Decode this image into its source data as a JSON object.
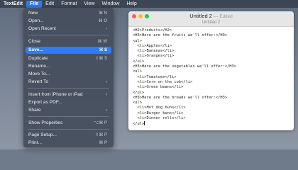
{
  "menubar": {
    "app": "TextEdit",
    "items": [
      "File",
      "Edit",
      "Format",
      "View",
      "Window",
      "Help"
    ]
  },
  "window": {
    "title": "Untitled 2",
    "title_suffix": "— Edited",
    "document_label": "Untitled 2"
  },
  "editor": {
    "lines": [
      "<H2>Products</H2>",
      "<H3>Here are the fruits we'll offer:</H3>",
      "<ul>",
      "  <li>Apples</li>",
      "  <li>Bananas</li>",
      "  <li>Oranges</li>",
      "</ul>",
      "<H3>Here are the vegetables we'll offer:</H3>",
      "<ul>",
      "  <li>Tomatoes</li>",
      "  <li>Corn on the cob</li>",
      "  <li>Green beans</li>",
      "</ul>",
      "<H3>Here are the breads we'll offer:</H3>",
      "<ul>",
      "  <li>Hot dog buns</li>",
      "  <li>Burger buns</li>",
      "  <li>Dinner rolls</li>",
      "</ul>"
    ]
  },
  "file_menu": {
    "new": "New",
    "new_sc": "⌘ N",
    "open": "Open...",
    "open_sc": "⌘ O",
    "open_recent": "Open Recent",
    "close": "Close",
    "close_sc": "⌘ W",
    "save": "Save...",
    "save_sc": "⌘ S",
    "duplicate": "Duplicate",
    "duplicate_sc": "⇧⌘ S",
    "rename": "Rename...",
    "move_to": "Move To...",
    "revert_to": "Revert To",
    "insert_from": "Insert from iPhone or iPad",
    "export_pdf": "Export as PDF...",
    "share": "Share",
    "show_properties": "Show Properties",
    "show_properties_sc": "⌥⌘ P",
    "page_setup": "Page Setup...",
    "page_setup_sc": "⇧⌘ P",
    "print": "Print...",
    "print_sc": "⌘ P"
  }
}
